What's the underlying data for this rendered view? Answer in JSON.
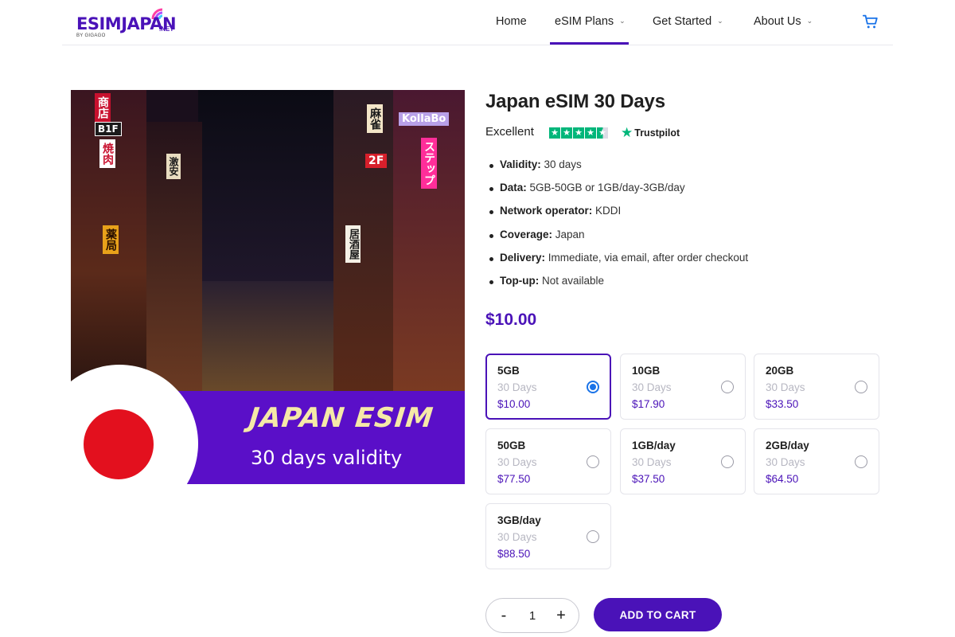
{
  "header": {
    "logo": {
      "esim": "ESIM",
      "japan": "JAPAN",
      "net": ".NET",
      "byline": "BY GIGAGO"
    },
    "nav": [
      {
        "label": "Home"
      },
      {
        "label": "eSIM Plans"
      },
      {
        "label": "Get Started"
      },
      {
        "label": "About Us"
      }
    ],
    "active_nav": "eSIM Plans"
  },
  "product": {
    "image": {
      "signs": [
        "商店",
        "B1F",
        "焼肉",
        "麻雀",
        "2F",
        "居酒屋",
        "KollaBo",
        "ステップ",
        "激安",
        "薬局"
      ],
      "banner_title": "JAPAN ESIM",
      "banner_subtitle": "30 days validity"
    },
    "title": "Japan eSIM 30 Days",
    "rating": {
      "label": "Excellent",
      "stars": 4.5,
      "provider": "Trustpilot"
    },
    "features": [
      {
        "key": "Validity:",
        "value": " 30 days"
      },
      {
        "key": "Data:",
        "value": " 5GB-50GB or 1GB/day-3GB/day"
      },
      {
        "key": "Network operator:",
        "value": " KDDI"
      },
      {
        "key": "Coverage:",
        "value": " Japan"
      },
      {
        "key": "Delivery:",
        "value": " Immediate, via email, after order checkout"
      },
      {
        "key": "Top-up:",
        "value": " Not available"
      }
    ],
    "price": "$10.00",
    "variants": [
      {
        "name": "5GB",
        "days": "30 Days",
        "price": "$10.00",
        "selected": true
      },
      {
        "name": "10GB",
        "days": "30 Days",
        "price": "$17.90",
        "selected": false
      },
      {
        "name": "20GB",
        "days": "30 Days",
        "price": "$33.50",
        "selected": false
      },
      {
        "name": "50GB",
        "days": "30 Days",
        "price": "$77.50",
        "selected": false
      },
      {
        "name": "1GB/day",
        "days": "30 Days",
        "price": "$37.50",
        "selected": false
      },
      {
        "name": "2GB/day",
        "days": "30 Days",
        "price": "$64.50",
        "selected": false
      },
      {
        "name": "3GB/day",
        "days": "30 Days",
        "price": "$88.50",
        "selected": false
      }
    ],
    "quantity": {
      "minus": "-",
      "value": "1",
      "plus": "+"
    },
    "add_to_cart": "ADD TO CART"
  },
  "colors": {
    "brand": "#4a12b8",
    "radio_selected": "#1a73e8",
    "trustpilot_green": "#00b67a",
    "flag_red": "#e3101e"
  }
}
